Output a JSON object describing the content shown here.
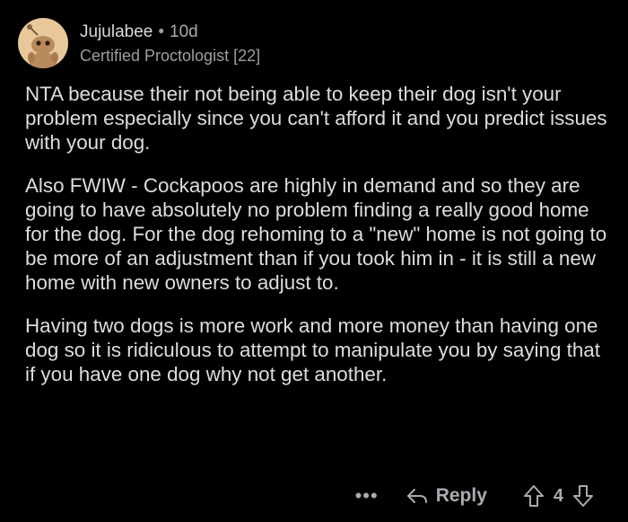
{
  "comment": {
    "author": "Jujulabee",
    "separator": "•",
    "age": "10d",
    "flair": "Certified Proctologist [22]",
    "avatar_icon": "snoo-avatar-icon",
    "paragraphs": [
      "NTA because their not being able to keep their dog isn't your problem especially since you can't afford it and you predict issues with your dog.",
      "Also FWIW - Cockapoos are highly in demand and so they are going to have absolutely no problem finding a really good home for the dog. For the dog rehoming to a \"new\" home is not going to be more of an adjustment than if you took him in - it is still a new home with new owners to adjust to.",
      "Having two dogs is more work and more money than having one dog so it is ridiculous to attempt to manipulate you by saying that if you have one dog why not get another."
    ]
  },
  "actions": {
    "more_label": "•••",
    "reply_label": "Reply",
    "reply_icon": "reply-arrow-icon",
    "upvote_icon": "upvote-arrow-icon",
    "downvote_icon": "downvote-arrow-icon",
    "score": "4"
  },
  "colors": {
    "background": "#000000",
    "text": "#dcdde0",
    "muted": "#a8acb0",
    "avatar_bg": "#e8c89a"
  }
}
